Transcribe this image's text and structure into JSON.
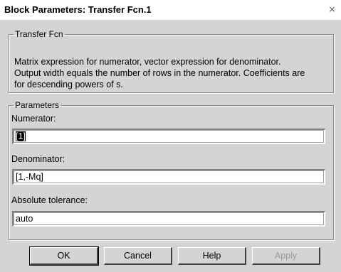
{
  "window": {
    "title": "Block Parameters: Transfer Fcn.1",
    "close_glyph": "×"
  },
  "transfer_group": {
    "legend": "Transfer Fcn",
    "description_line1": "Matrix expression for numerator, vector expression for denominator.",
    "description_line2": "Output width equals the number of rows in the numerator.  Coefficients are",
    "description_line3": "for descending powers of s."
  },
  "parameters_group": {
    "legend": "Parameters",
    "numerator": {
      "label": "Numerator:",
      "value": "[1]"
    },
    "denominator": {
      "label": "Denominator:",
      "value": "[1,-Mq]"
    },
    "tolerance": {
      "label": "Absolute tolerance:",
      "value": "auto"
    }
  },
  "buttons": {
    "ok": "OK",
    "cancel": "Cancel",
    "help": "Help",
    "apply": "Apply"
  },
  "colors": {
    "dialog_bg": "#d4d4d4",
    "input_bg": "#ffffff",
    "disabled_text": "#9a9a9a"
  }
}
